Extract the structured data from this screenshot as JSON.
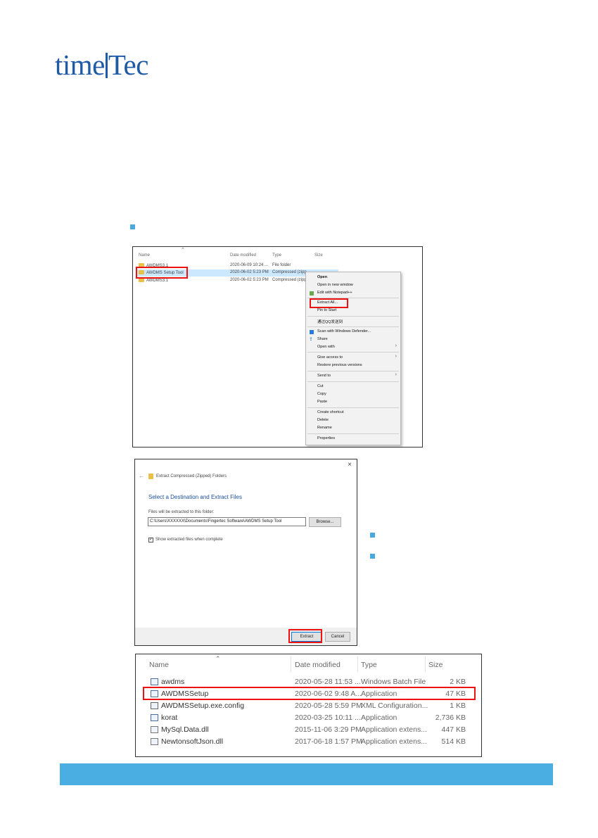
{
  "logo": {
    "part1": "time",
    "part2": "Tec"
  },
  "explorer1": {
    "headers": {
      "name": "Name",
      "date": "Date modified",
      "type": "Type",
      "size": "Size"
    },
    "rows": [
      {
        "name": "AWDMS3.1",
        "date": "2020-06-09 10:24 ...",
        "type": "File folder"
      },
      {
        "name": "AWDMS Setup Tool",
        "date": "2020-06-02 5:23 PM",
        "type": "Compressed (zipp..."
      },
      {
        "name": "AWDMS3.1",
        "date": "2020-06-02 5:23 PM",
        "type": "Compressed (zipp..."
      }
    ]
  },
  "context_menu": {
    "items": [
      "Open",
      "Open in new window",
      "Edit with Notepad++",
      "Extract All...",
      "Pin to Start",
      "通过QQ发送到",
      "Scan with Windows Defender...",
      "Share",
      "Open with",
      "Give access to",
      "Restore previous versions",
      "Send to",
      "Cut",
      "Copy",
      "Paste",
      "Create shortcut",
      "Delete",
      "Rename",
      "Properties"
    ]
  },
  "dialog": {
    "title": "Extract Compressed (Zipped) Folders",
    "heading": "Select a Destination and Extract Files",
    "label": "Files will be extracted to this folder:",
    "path": "C:\\Users\\XXXXXX\\Documents\\Fingertec Software\\AWDMS Setup Tool",
    "browse": "Browse...",
    "checkbox_label": "Show extracted files when complete",
    "extract": "Extract",
    "cancel": "Cancel"
  },
  "explorer2": {
    "headers": {
      "name": "Name",
      "date": "Date modified",
      "type": "Type",
      "size": "Size"
    },
    "rows": [
      {
        "name": "awdms",
        "date": "2020-05-28 11:53 ...",
        "type": "Windows Batch File",
        "size": "2 KB"
      },
      {
        "name": "AWDMSSetup",
        "date": "2020-06-02 9:48 A...",
        "type": "Application",
        "size": "47 KB"
      },
      {
        "name": "AWDMSSetup.exe.config",
        "date": "2020-05-28 5:59 PM",
        "type": "XML Configuration...",
        "size": "1 KB"
      },
      {
        "name": "korat",
        "date": "2020-03-25 10:11 ...",
        "type": "Application",
        "size": "2,736 KB"
      },
      {
        "name": "MySql.Data.dll",
        "date": "2015-11-06 3:29 PM",
        "type": "Application extens...",
        "size": "447 KB"
      },
      {
        "name": "NewtonsoftJson.dll",
        "date": "2017-06-18 1:57 PM",
        "type": "Application extens...",
        "size": "514 KB"
      }
    ]
  },
  "colors": {
    "brand": "#1f5aa6",
    "accent": "#4aaee3",
    "highlight": "#e11111"
  }
}
